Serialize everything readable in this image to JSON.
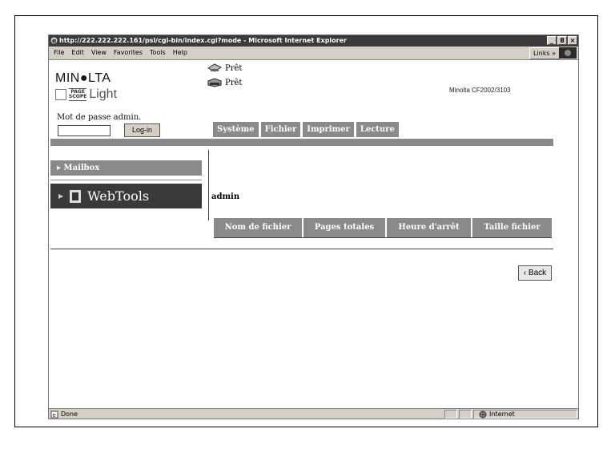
{
  "window": {
    "title": "http://222.222.222.161/psl/cgi-bin/index.cgi?mode - Microsoft Internet Explorer",
    "buttons": [
      "_",
      "8",
      "×"
    ]
  },
  "menubar": {
    "items": [
      "File",
      "Edit",
      "View",
      "Favorites",
      "Tools",
      "Help"
    ],
    "links": "Links »"
  },
  "header": {
    "brand": "MIN●LTA",
    "product_box_top": "PAGE",
    "product_box_bottom": "SCOPE",
    "product_name": "Light",
    "status_lines": [
      "Prêt",
      "Prêt"
    ],
    "device_name": "Minolta CF2002/3103"
  },
  "login": {
    "label": "Mot de passe admin.",
    "input_value": "",
    "button": "Log-in"
  },
  "tabs": [
    "Système",
    "Fichier",
    "Imprimer",
    "Lecture"
  ],
  "sidebar": {
    "mailbox": "Mailbox",
    "webtools": "WebTools"
  },
  "main": {
    "user": "admin",
    "columns": [
      "Nom de fichier",
      "Pages totales",
      "Heure d'arrêt",
      "Taille fichier"
    ],
    "back_button": "‹ Back"
  },
  "statusbar": {
    "text": "Done",
    "zone": "Internet"
  }
}
